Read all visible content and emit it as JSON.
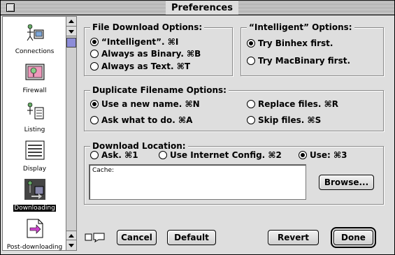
{
  "window": {
    "title": "Preferences"
  },
  "sidebar": {
    "items": [
      {
        "label": "Connections",
        "icon": "connections-icon",
        "selected": false
      },
      {
        "label": "Firewall",
        "icon": "firewall-icon",
        "selected": false
      },
      {
        "label": "Listing",
        "icon": "listing-icon",
        "selected": false
      },
      {
        "label": "Display",
        "icon": "display-icon",
        "selected": false
      },
      {
        "label": "Downloading",
        "icon": "downloading-icon",
        "selected": true
      },
      {
        "label": "Post-downloading",
        "icon": "post-downloading-icon",
        "selected": false
      }
    ]
  },
  "file_download": {
    "title": "File Download Options:",
    "options": [
      {
        "label": "“Intelligent”. ⌘I",
        "checked": true
      },
      {
        "label": "Always as Binary. ⌘B",
        "checked": false
      },
      {
        "label": "Always as Text. ⌘T",
        "checked": false
      }
    ]
  },
  "intelligent": {
    "title": "“Intelligent” Options:",
    "options": [
      {
        "label": "Try Binhex first.",
        "checked": true
      },
      {
        "label": "Try MacBinary first.",
        "checked": false
      }
    ]
  },
  "duplicate": {
    "title": "Duplicate Filename Options:",
    "options": [
      {
        "label": "Use a new name. ⌘N",
        "checked": true
      },
      {
        "label": "Replace files. ⌘R",
        "checked": false
      },
      {
        "label": "Ask what to do. ⌘A",
        "checked": false
      },
      {
        "label": "Skip files. ⌘S",
        "checked": false
      }
    ]
  },
  "location": {
    "title": "Download Location:",
    "options": [
      {
        "label": "Ask. ⌘1",
        "checked": false
      },
      {
        "label": "Use Internet Config. ⌘2",
        "checked": false
      },
      {
        "label": "Use: ⌘3",
        "checked": true
      }
    ],
    "path": "Cache:",
    "browse_label": "Browse..."
  },
  "buttons": {
    "cancel": "Cancel",
    "default": "Default",
    "revert": "Revert",
    "done": "Done"
  },
  "colors": {
    "window_bg": "#dedede",
    "thumb": "#8c8cd8"
  }
}
